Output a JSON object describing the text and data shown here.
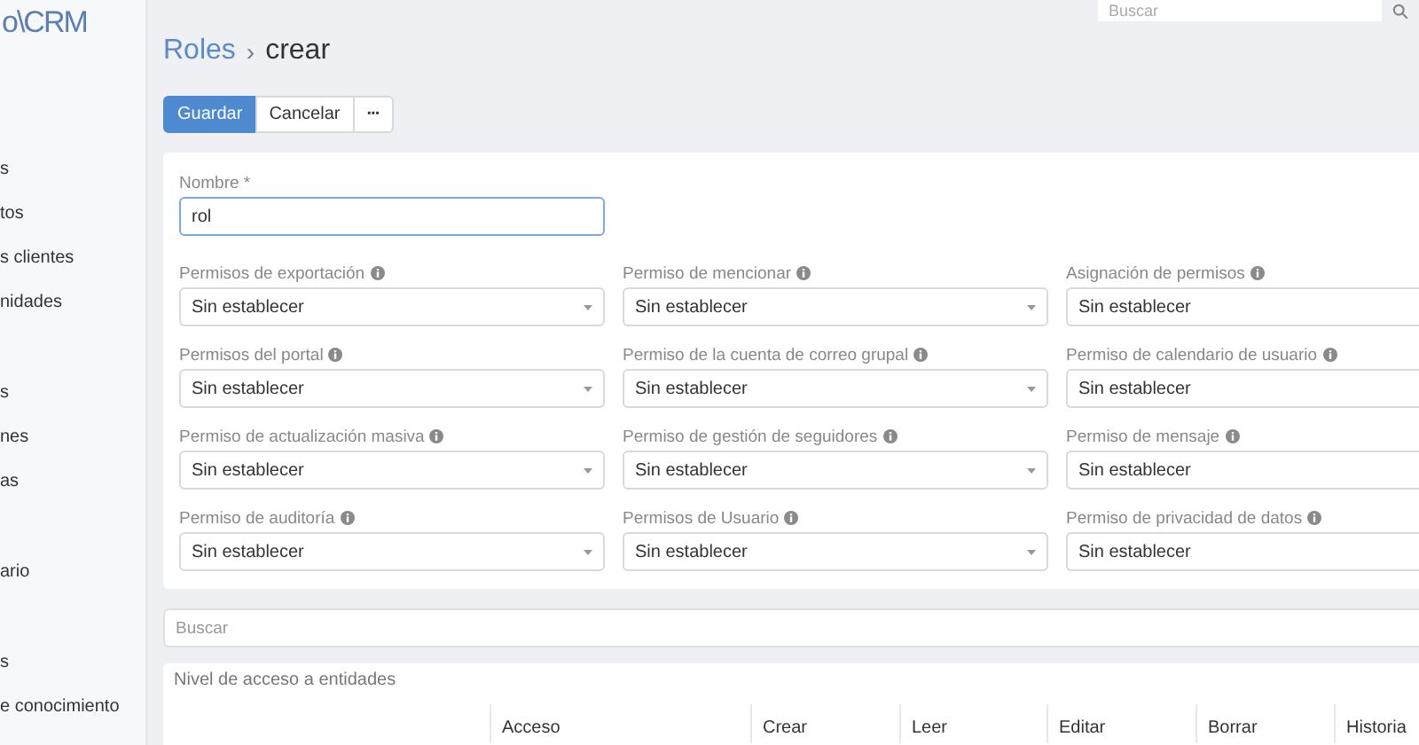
{
  "sidebar": {
    "logo": "o\\CRM",
    "items": [
      {
        "label": "s"
      },
      {
        "label": "tos"
      },
      {
        "label": "s clientes"
      },
      {
        "label": "nidades"
      },
      {
        "label": "s"
      },
      {
        "label": "nes"
      },
      {
        "label": "as"
      },
      {
        "label": "ario"
      },
      {
        "label": "s"
      },
      {
        "label": "e conocimiento"
      }
    ]
  },
  "top_search": {
    "placeholder": "Buscar"
  },
  "breadcrumb": {
    "parent": "Roles",
    "separator": "›",
    "current": "crear"
  },
  "buttons": [
    {
      "label": "Guardar",
      "kind": "primary"
    },
    {
      "label": "Cancelar",
      "kind": "default"
    },
    {
      "label": "···",
      "kind": "more"
    }
  ],
  "name_field": {
    "label": "Nombre *",
    "value": "rol"
  },
  "permissions": [
    {
      "label": "Permisos de exportación",
      "value": "Sin establecer"
    },
    {
      "label": "Permiso de mencionar",
      "value": "Sin establecer"
    },
    {
      "label": "Asignación de permisos",
      "value": "Sin establecer"
    },
    {
      "label": "Permisos del portal",
      "value": "Sin establecer"
    },
    {
      "label": "Permiso de la cuenta de correo grupal",
      "value": "Sin establecer"
    },
    {
      "label": "Permiso de calendario de usuario",
      "value": "Sin establecer"
    },
    {
      "label": "Permiso de actualización masiva",
      "value": "Sin establecer"
    },
    {
      "label": "Permiso de gestión de seguidores",
      "value": "Sin establecer"
    },
    {
      "label": "Permiso de mensaje",
      "value": "Sin establecer"
    },
    {
      "label": "Permiso de auditoría",
      "value": "Sin establecer"
    },
    {
      "label": "Permisos de Usuario",
      "value": "Sin establecer"
    },
    {
      "label": "Permiso de privacidad de datos",
      "value": "Sin establecer"
    }
  ],
  "search": {
    "placeholder": "Buscar"
  },
  "access_table": {
    "title": "Nivel de acceso a entidades",
    "columns": [
      "Acceso",
      "Crear",
      "Leer",
      "Editar",
      "Borrar",
      "Historia"
    ]
  }
}
